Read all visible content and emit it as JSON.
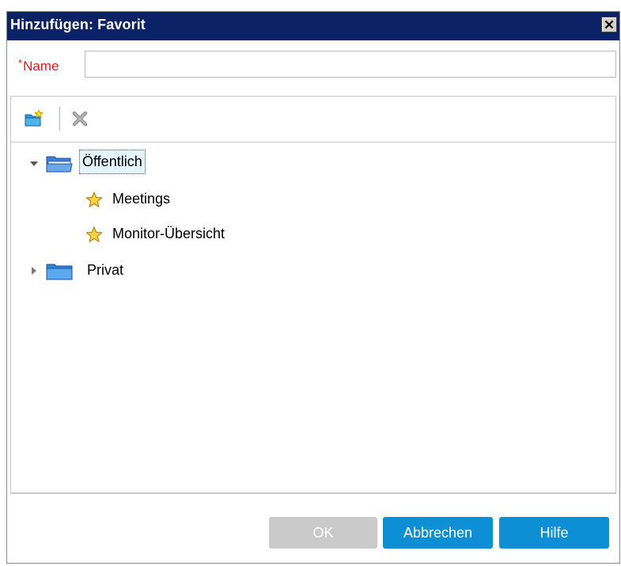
{
  "window": {
    "title": "Hinzufügen: Favorit",
    "close_icon": "close-icon"
  },
  "form": {
    "name_label": "Name",
    "name_required_marker": "*",
    "name_value": "",
    "name_placeholder": ""
  },
  "toolbar": {
    "new_folder_icon": "new-folder-icon",
    "delete_icon": "delete-icon"
  },
  "tree": {
    "items": [
      {
        "label": "Öffentlich",
        "type": "folder",
        "expanded": true,
        "selected": true
      },
      {
        "label": "Meetings",
        "type": "favorite"
      },
      {
        "label": "Monitor-Übersicht",
        "type": "favorite"
      },
      {
        "label": "Privat",
        "type": "folder",
        "expanded": false,
        "selected": false
      }
    ]
  },
  "buttons": {
    "ok_label": "OK",
    "ok_enabled": false,
    "cancel_label": "Abbrechen",
    "help_label": "Hilfe"
  },
  "colors": {
    "titlebar": "#0b2366",
    "required": "#e41b1b",
    "primary_button": "#0d8fd6",
    "disabled_button": "#cacaca",
    "selection": "#e3f4fd"
  }
}
